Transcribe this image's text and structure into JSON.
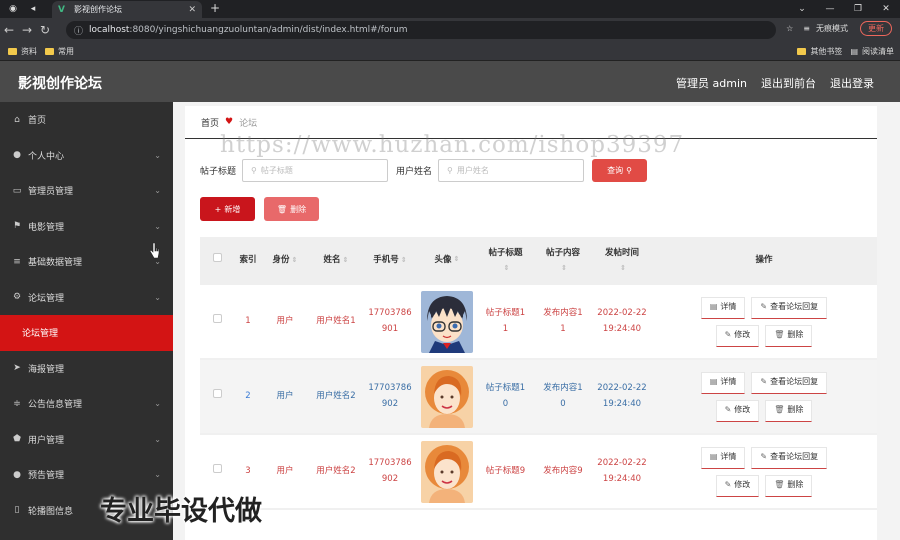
{
  "browser": {
    "tab_title": "影视创作论坛",
    "url_host": "localhost",
    "url_rest": ":8080/yingshichuangzuoluntan/admin/dist/index.html#/forum",
    "incognito_label": "无痕模式",
    "update_label": "更新",
    "bookmarks": [
      "资料",
      "常用"
    ],
    "bookmarks_right": [
      "其他书签",
      "阅读清单"
    ]
  },
  "header": {
    "title": "影视创作论坛",
    "admin_label": "管理员 admin",
    "back_label": "退出到前台",
    "logout_label": "退出登录"
  },
  "sidebar": {
    "items": [
      {
        "label": "首页",
        "icon": "home-icon",
        "arrow": false
      },
      {
        "label": "个人中心",
        "icon": "user-icon",
        "arrow": true
      },
      {
        "label": "管理员管理",
        "icon": "chat-icon",
        "arrow": true
      },
      {
        "label": "电影管理",
        "icon": "flag-icon",
        "arrow": true
      },
      {
        "label": "基础数据管理",
        "icon": "list-icon",
        "arrow": true
      },
      {
        "label": "论坛管理",
        "icon": "gear-icon",
        "arrow": true
      },
      {
        "label": "论坛管理",
        "icon": "",
        "arrow": false,
        "sub": true,
        "active": true
      },
      {
        "label": "海报管理",
        "icon": "send-icon",
        "arrow": false
      },
      {
        "label": "公告信息管理",
        "icon": "sliders-icon",
        "arrow": true
      },
      {
        "label": "用户管理",
        "icon": "shield-icon",
        "arrow": true
      },
      {
        "label": "预告管理",
        "icon": "user-icon",
        "arrow": true
      },
      {
        "label": "轮播图信息",
        "icon": "phone-icon",
        "arrow": false
      }
    ]
  },
  "breadcrumb": {
    "home": "首页",
    "current": "论坛"
  },
  "search": {
    "title_label": "帖子标题",
    "title_placeholder": "帖子标题",
    "user_label": "用户姓名",
    "user_placeholder": "用户姓名",
    "query_label": "查询"
  },
  "actions": {
    "add_label": "新增",
    "delete_label": "删除"
  },
  "table": {
    "headers": [
      "索引",
      "身份",
      "姓名",
      "手机号",
      "头像",
      "帖子标题",
      "帖子内容",
      "发帖时间",
      "操作"
    ],
    "rows": [
      {
        "idx": "1",
        "role": "用户",
        "name": "用户姓名1",
        "phone": "17703786901",
        "title": "帖子标题11",
        "content": "发布内容11",
        "time": "2022-02-22 19:24:40",
        "avatar": "anime"
      },
      {
        "idx": "2",
        "role": "用户",
        "name": "用户姓名2",
        "phone": "17703786902",
        "title": "帖子标题10",
        "content": "发布内容10",
        "time": "2022-02-22 19:24:40",
        "avatar": "woman"
      },
      {
        "idx": "3",
        "role": "用户",
        "name": "用户姓名2",
        "phone": "17703786902",
        "title": "帖子标题9",
        "content": "发布内容9",
        "time": "2022-02-22 19:24:40",
        "avatar": "woman"
      }
    ],
    "ops": {
      "detail": "详情",
      "view_replies": "查看论坛回复",
      "edit": "修改",
      "delete": "删除"
    }
  },
  "watermarks": {
    "url": "https://www.huzhan.com/ishop39397",
    "caption": "专业毕设代做"
  }
}
